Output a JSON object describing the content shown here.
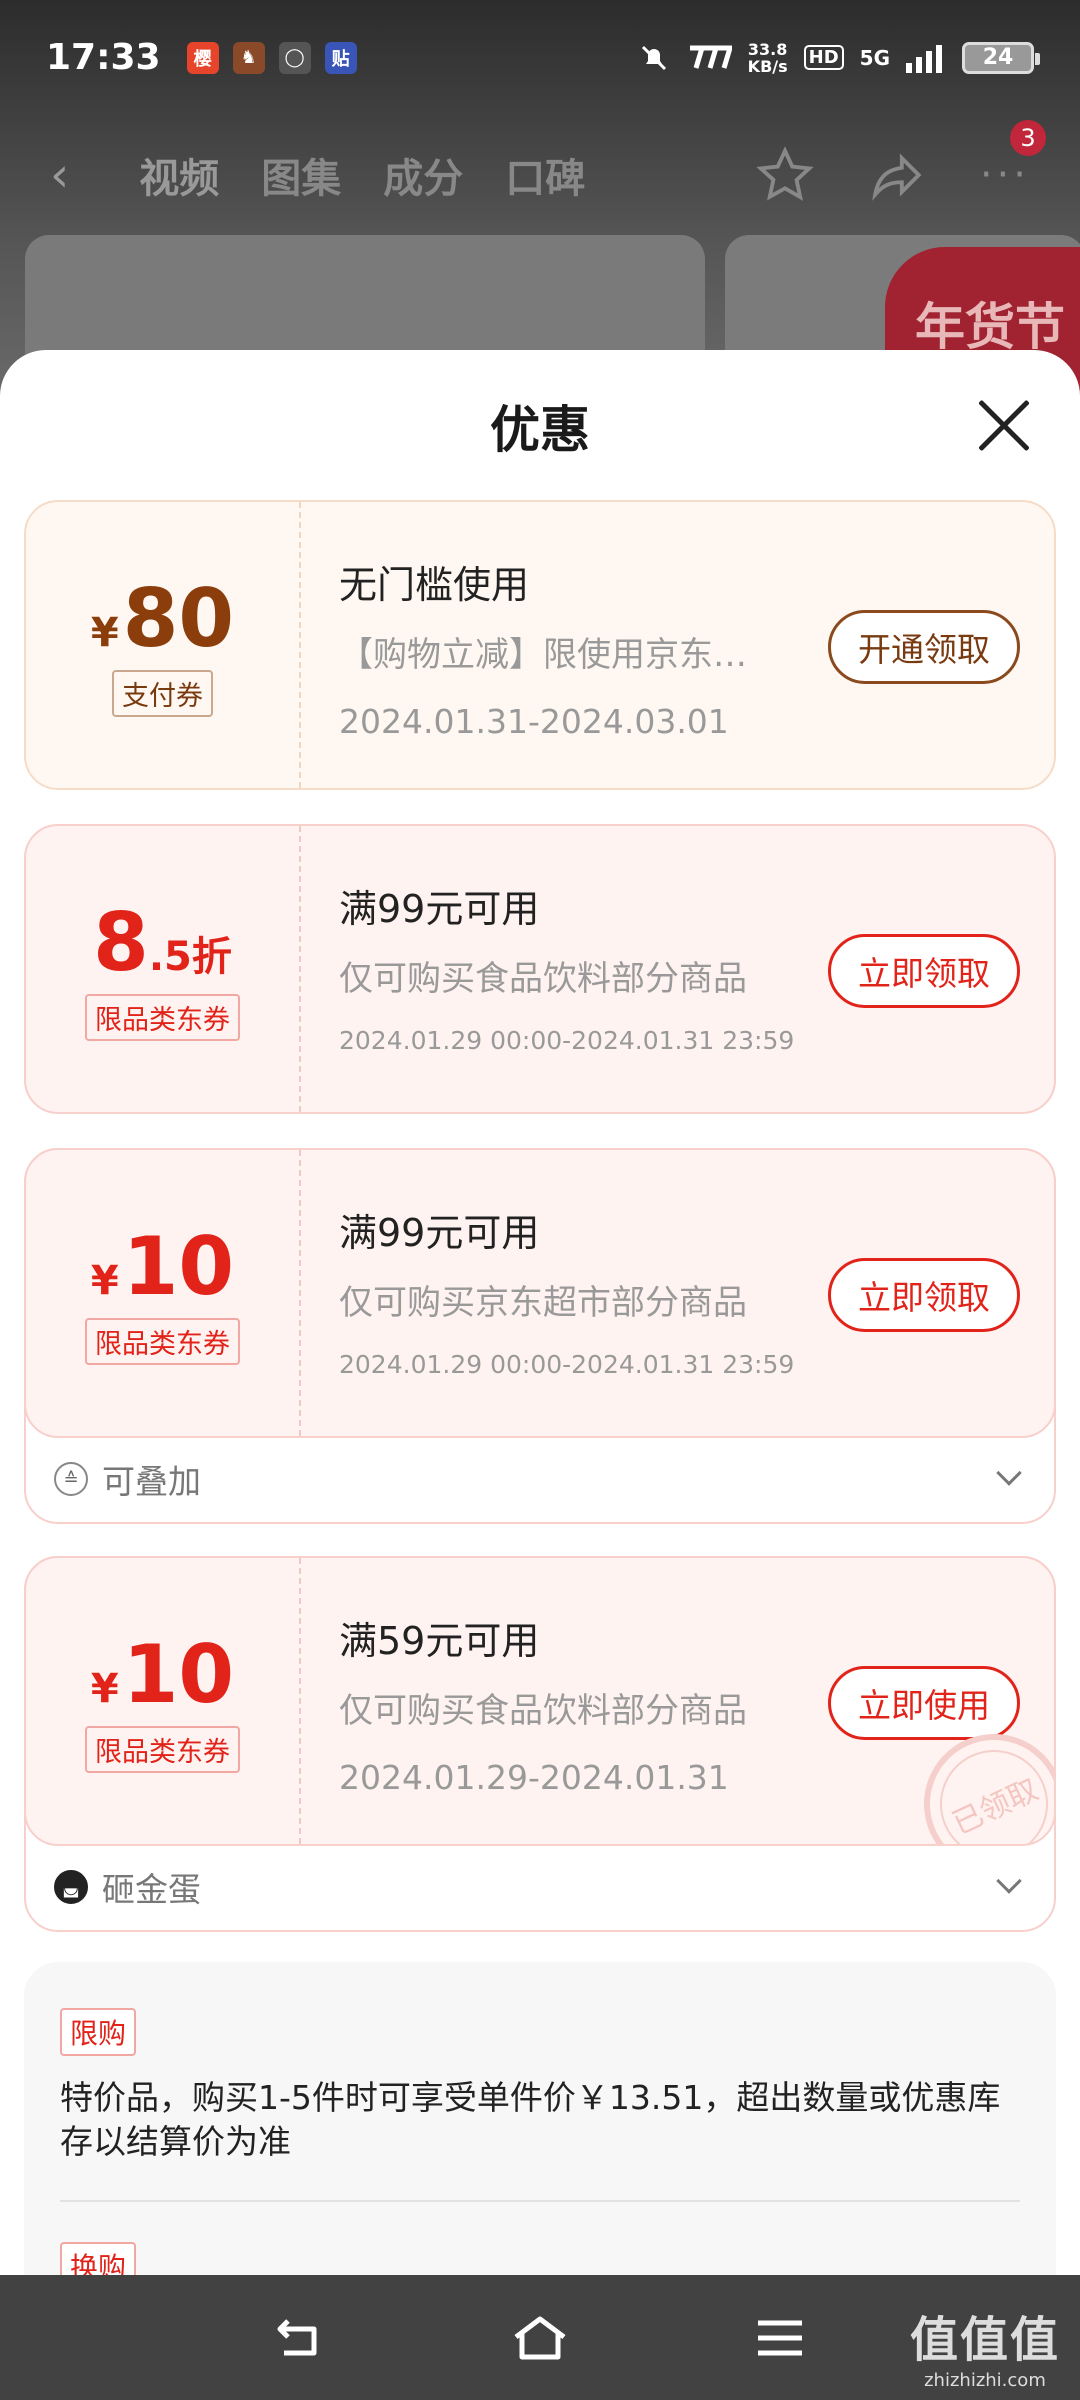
{
  "status_bar": {
    "time": "17:33",
    "apps": [
      {
        "icon": "app-icon-1",
        "glyph": "樱",
        "color": "#e6452b"
      },
      {
        "icon": "app-icon-2",
        "glyph": "♞",
        "color": "#8a4a2a"
      },
      {
        "icon": "app-icon-3",
        "glyph": "◯",
        "color": "#666666"
      },
      {
        "icon": "app-icon-4",
        "glyph": "贴",
        "color": "#3a55b8"
      }
    ],
    "speed_value": "33.8",
    "speed_unit": "KB/s",
    "hd": "HD",
    "signal": "5G",
    "battery": "24"
  },
  "nav": {
    "tabs": [
      "视频",
      "图集",
      "成分",
      "口碑"
    ],
    "badge": "3",
    "bg_banner": "年货节"
  },
  "sheet": {
    "title": "优惠"
  },
  "coupons": [
    {
      "style": "gold",
      "symbol": "¥",
      "amount": "80",
      "suffix": "",
      "tag": "支付券",
      "title": "无门槛使用",
      "desc": "【购物立减】限使用京东…",
      "date": "2024.01.31-2024.03.01",
      "button": "开通领取"
    },
    {
      "style": "red",
      "symbol": "",
      "amount": "8",
      "suffix": ".5折",
      "tag": "限品类东券",
      "title": "满99元可用",
      "desc": "仅可购买食品饮料部分商品",
      "date": "2024.01.29 00:00-2024.01.31 23:59",
      "button": "立即领取"
    },
    {
      "style": "red",
      "symbol": "¥",
      "amount": "10",
      "suffix": "",
      "tag": "限品类东券",
      "title": "满99元可用",
      "desc": "仅可购买京东超市部分商品",
      "date": "2024.01.29 00:00-2024.01.31 23:59",
      "button": "立即领取",
      "expand": "可叠加"
    },
    {
      "style": "red",
      "symbol": "¥",
      "amount": "10",
      "suffix": "",
      "tag": "限品类东券",
      "title": "满59元可用",
      "desc": "仅可购买食品饮料部分商品",
      "date": "2024.01.29-2024.01.31",
      "button": "立即使用",
      "stamp": "已领取",
      "expand": "砸金蛋"
    }
  ],
  "limit": {
    "tag": "限购",
    "text": "特价品，购买1-5件时可享受单件价￥13.51，超出数量或优惠库存以结算价为准",
    "tag2": "换购"
  },
  "watermark": {
    "big": "值值值",
    "small": "zhizhizhi.com"
  },
  "colors": {
    "accent_red": "#e2231a",
    "gold": "#8b3e0c"
  }
}
